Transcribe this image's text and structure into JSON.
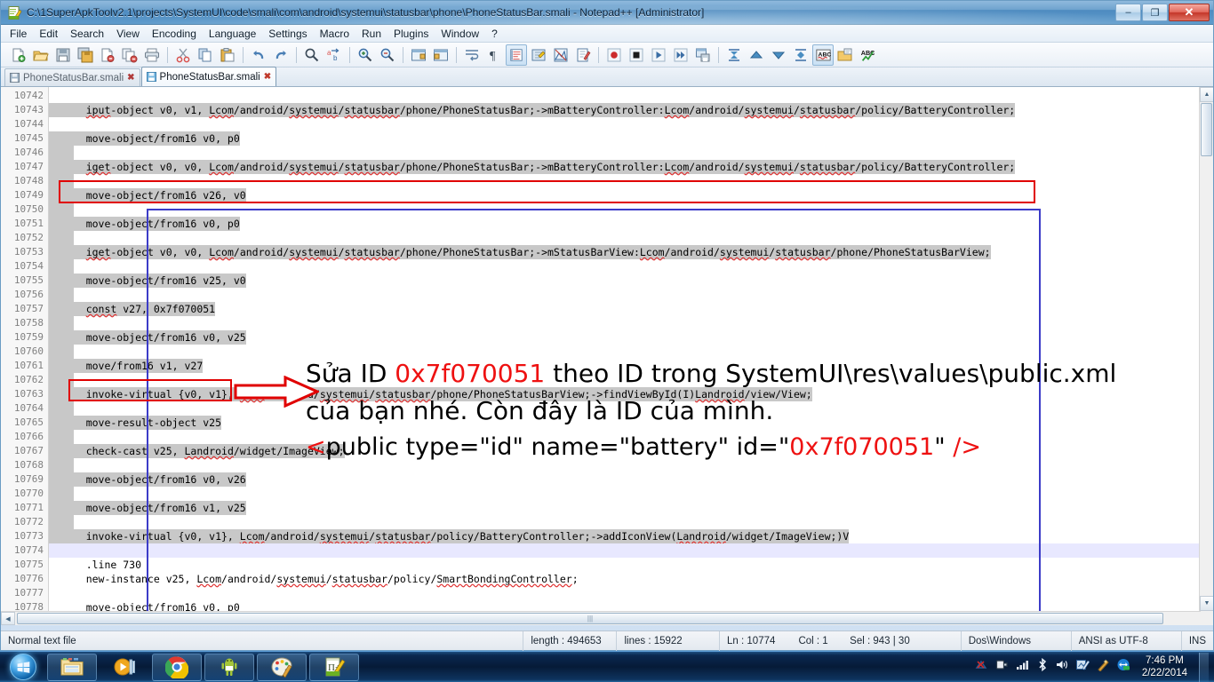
{
  "window": {
    "title": "C:\\1SuperApkToolv2.1\\projects\\SystemUI\\code\\smali\\com\\android\\systemui\\statusbar\\phone\\PhoneStatusBar.smali - Notepad++ [Administrator]",
    "minimize_label": "–",
    "maximize_label": "❐",
    "close_label": "✕"
  },
  "menu": {
    "items": [
      {
        "label": "File"
      },
      {
        "label": "Edit"
      },
      {
        "label": "Search"
      },
      {
        "label": "View"
      },
      {
        "label": "Encoding"
      },
      {
        "label": "Language"
      },
      {
        "label": "Settings"
      },
      {
        "label": "Macro"
      },
      {
        "label": "Run"
      },
      {
        "label": "Plugins"
      },
      {
        "label": "Window"
      },
      {
        "label": "?"
      }
    ]
  },
  "toolbar": {
    "icons": [
      "new-file-icon",
      "open-file-icon",
      "save-icon",
      "save-all-icon",
      "close-file-icon",
      "close-all-icon",
      "print-icon",
      "sep",
      "cut-icon",
      "copy-icon",
      "paste-icon",
      "sep",
      "undo-icon",
      "redo-icon",
      "sep",
      "find-icon",
      "replace-icon",
      "sep",
      "zoom-in-icon",
      "zoom-out-icon",
      "sep",
      "sync-vertical-scroll-icon",
      "sync-horizontal-scroll-icon",
      "sep",
      "word-wrap-icon",
      "show-all-chars-icon",
      "show-indent-guide-icon",
      "user-defined-dialog-icon",
      "show-doc-map-icon",
      "show-func-list-icon",
      "sep",
      "macro-record-icon",
      "macro-stop-icon",
      "macro-play-icon",
      "macro-playback-multiple-icon",
      "macro-save-icon",
      "sep",
      "collapse-all-icon",
      "fold-level-up-icon",
      "fold-level-down-icon",
      "uncollapse-all-icon",
      "spell-check-icon",
      "document-list-icon",
      "run-spellcheck-icon"
    ]
  },
  "tabs": [
    {
      "label": "PhoneStatusBar.smali",
      "active": false,
      "close": "✖"
    },
    {
      "label": "PhoneStatusBar.smali",
      "active": true,
      "close": "✖"
    }
  ],
  "editor": {
    "first_line_number": 10742,
    "lines": [
      {
        "n": 10742,
        "text": "",
        "sel": false
      },
      {
        "n": 10743,
        "text": "    iput-object v0, v1, Lcom/android/systemui/statusbar/phone/PhoneStatusBar;->mBatteryController:Lcom/android/systemui/statusbar/policy/BatteryController;",
        "sel": true
      },
      {
        "n": 10744,
        "text": "",
        "sel": false
      },
      {
        "n": 10745,
        "text": "    move-object/from16 v0, p0",
        "sel": true
      },
      {
        "n": 10746,
        "text": "",
        "sel": true
      },
      {
        "n": 10747,
        "text": "    iget-object v0, v0, Lcom/android/systemui/statusbar/phone/PhoneStatusBar;->mBatteryController:Lcom/android/systemui/statusbar/policy/BatteryController;",
        "sel": true
      },
      {
        "n": 10748,
        "text": "",
        "sel": true
      },
      {
        "n": 10749,
        "text": "    move-object/from16 v26, v0",
        "sel": true
      },
      {
        "n": 10750,
        "text": "",
        "sel": true
      },
      {
        "n": 10751,
        "text": "    move-object/from16 v0, p0",
        "sel": true
      },
      {
        "n": 10752,
        "text": "",
        "sel": true
      },
      {
        "n": 10753,
        "text": "    iget-object v0, v0, Lcom/android/systemui/statusbar/phone/PhoneStatusBar;->mStatusBarView:Lcom/android/systemui/statusbar/phone/PhoneStatusBarView;",
        "sel": true
      },
      {
        "n": 10754,
        "text": "",
        "sel": true
      },
      {
        "n": 10755,
        "text": "    move-object/from16 v25, v0",
        "sel": true
      },
      {
        "n": 10756,
        "text": "",
        "sel": true
      },
      {
        "n": 10757,
        "text": "    const v27, 0x7f070051",
        "sel": true
      },
      {
        "n": 10758,
        "text": "",
        "sel": true
      },
      {
        "n": 10759,
        "text": "    move-object/from16 v0, v25",
        "sel": true
      },
      {
        "n": 10760,
        "text": "",
        "sel": true
      },
      {
        "n": 10761,
        "text": "    move/from16 v1, v27",
        "sel": true
      },
      {
        "n": 10762,
        "text": "",
        "sel": true
      },
      {
        "n": 10763,
        "text": "    invoke-virtual {v0, v1}, Lcom/android/systemui/statusbar/phone/PhoneStatusBarView;->findViewById(I)Landroid/view/View;",
        "sel": true
      },
      {
        "n": 10764,
        "text": "",
        "sel": true
      },
      {
        "n": 10765,
        "text": "    move-result-object v25",
        "sel": true
      },
      {
        "n": 10766,
        "text": "",
        "sel": true
      },
      {
        "n": 10767,
        "text": "    check-cast v25, Landroid/widget/ImageView;",
        "sel": true
      },
      {
        "n": 10768,
        "text": "",
        "sel": true
      },
      {
        "n": 10769,
        "text": "    move-object/from16 v0, v26",
        "sel": true
      },
      {
        "n": 10770,
        "text": "",
        "sel": true
      },
      {
        "n": 10771,
        "text": "    move-object/from16 v1, v25",
        "sel": true
      },
      {
        "n": 10772,
        "text": "",
        "sel": true
      },
      {
        "n": 10773,
        "text": "    invoke-virtual {v0, v1}, Lcom/android/systemui/statusbar/policy/BatteryController;->addIconView(Landroid/widget/ImageView;)V",
        "sel": true
      },
      {
        "n": 10774,
        "text": "",
        "sel": false,
        "caret_line": true
      },
      {
        "n": 10775,
        "text": "    .line 730",
        "sel": false
      },
      {
        "n": 10776,
        "text": "    new-instance v25, Lcom/android/systemui/statusbar/policy/SmartBondingController;",
        "sel": false
      },
      {
        "n": 10777,
        "text": "",
        "sel": false
      },
      {
        "n": 10778,
        "text": "    move-object/from16 v0, p0",
        "sel": false
      }
    ]
  },
  "annotation": {
    "line1_a": "Sửa ID ",
    "line1_id": "0x7f070051",
    "line1_b": " theo ID trong SystemUI\\res\\values\\public.xml",
    "line2": "của bạn nhé. Còn đây là ID của mình.",
    "xml_open": "<",
    "xml_body": "public type=\"id\" name=\"battery\" id=\"",
    "xml_id": "0x7f070051",
    "xml_tail_quote": "\"",
    "xml_close": " />",
    "red_color": "#ee1111",
    "blue_box_color": "#3c3cc8",
    "red_box_color": "#e00000"
  },
  "status_bar": {
    "file_type": "Normal text file",
    "length": "length : 494653",
    "lines": "lines : 15922",
    "ln": "Ln : 10774",
    "col": "Col : 1",
    "sel": "Sel : 943 | 30",
    "eol": "Dos\\Windows",
    "encoding": "ANSI as UTF-8",
    "insert_mode": "INS"
  },
  "taskbar": {
    "start_label": "start-orb",
    "items": [
      {
        "name": "taskbar-item-explorer",
        "icon": "folder-icon"
      },
      {
        "name": "taskbar-item-media-player",
        "icon": "media-player-icon"
      },
      {
        "name": "taskbar-item-chrome",
        "icon": "chrome-icon"
      },
      {
        "name": "taskbar-item-android-tool",
        "icon": "android-icon"
      },
      {
        "name": "taskbar-item-paint",
        "icon": "paint-palette-icon"
      },
      {
        "name": "taskbar-item-notepadpp",
        "icon": "notepadpp-icon"
      }
    ],
    "tray": [
      {
        "name": "network-disconnected-icon"
      },
      {
        "name": "power-plug-icon"
      },
      {
        "name": "signal-bars-icon"
      },
      {
        "name": "bluetooth-icon"
      },
      {
        "name": "volume-icon"
      },
      {
        "name": "tray-app-icon"
      },
      {
        "name": "tray-wand-icon"
      },
      {
        "name": "teamviewer-icon"
      }
    ],
    "clock_time": "7:46 PM",
    "clock_date": "2/22/2014"
  }
}
